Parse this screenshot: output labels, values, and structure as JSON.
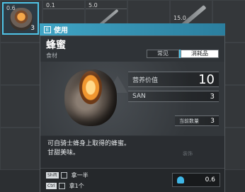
{
  "inventory": {
    "slots": [
      {
        "value": "0.6",
        "count": "3"
      },
      {
        "value": "0.1",
        "count": ""
      },
      {
        "value": "5.0",
        "count": ""
      },
      {
        "value": "15.0",
        "count": ""
      }
    ]
  },
  "use_bar": {
    "key": "E",
    "label": "使用"
  },
  "item": {
    "name": "蜂蜜",
    "type": "食材",
    "tabs": [
      "常见",
      "消耗品"
    ],
    "stats": {
      "nutrition_label": "营养价值",
      "nutrition_value": "10",
      "san_label": "SAN",
      "san_value": "3",
      "quantity_label": "当前数量",
      "quantity_value": "3"
    },
    "description": [
      "可自骑士蜂身上取得的蜂蜜。",
      "甘甜美味。"
    ],
    "faded_text": "装饰"
  },
  "hints": [
    {
      "key": "Shift",
      "label": "拿一半"
    },
    {
      "key": "Ctrl",
      "label": "拿1个"
    }
  ],
  "weight": "0.6"
}
